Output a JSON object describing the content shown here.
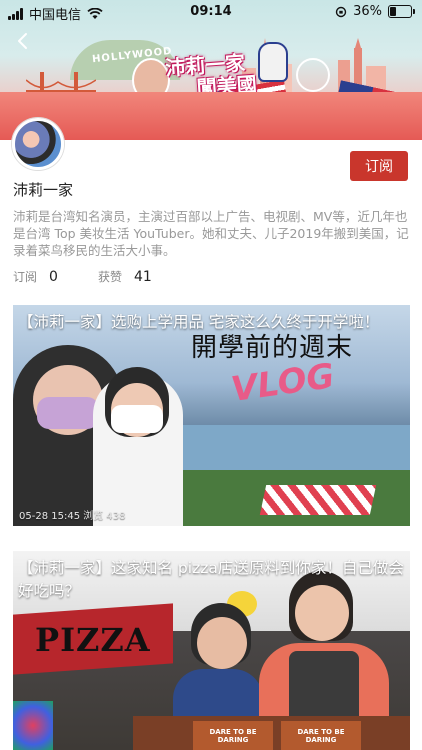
{
  "status_bar": {
    "carrier": "中国电信",
    "time": "09:14",
    "battery_percent": "36%",
    "battery_level": 0.36
  },
  "banner": {
    "title_line1": "沛莉一家",
    "title_line2": "闖美國",
    "sign_text": "HOLLYWOOD"
  },
  "channel": {
    "name": "沛莉一家",
    "subscribe_label": "订阅",
    "description": "沛莉是台湾知名演员，主演过百部以上广告、电视剧、MV等，近几年也是台湾 Top 美妆生活 YouTuber。她和丈夫、儿子2019年搬到美国，记录着菜鸟移民的生活大小事。",
    "stats": {
      "subscribe_label": "订阅",
      "subscribe_count": "0",
      "likes_label": "获赞",
      "likes_count": "41"
    }
  },
  "videos": [
    {
      "title": "【沛莉一家】选购上学用品 宅家这么久终于开学啦！",
      "thumb_text": "開學前的週末",
      "thumb_text2": "VLOG",
      "meta": "05-28 15:45  浏览 438"
    },
    {
      "title": "【沛莉一家】这家知名 pizza店送原料到你家！自己做会好吃吗？",
      "thumb_text": "PIZZA",
      "box1": "DARE TO BE DARING",
      "box2": "DARE TO BE DARING"
    }
  ],
  "colors": {
    "accent": "#c9362c",
    "secondary_text": "#999999"
  }
}
